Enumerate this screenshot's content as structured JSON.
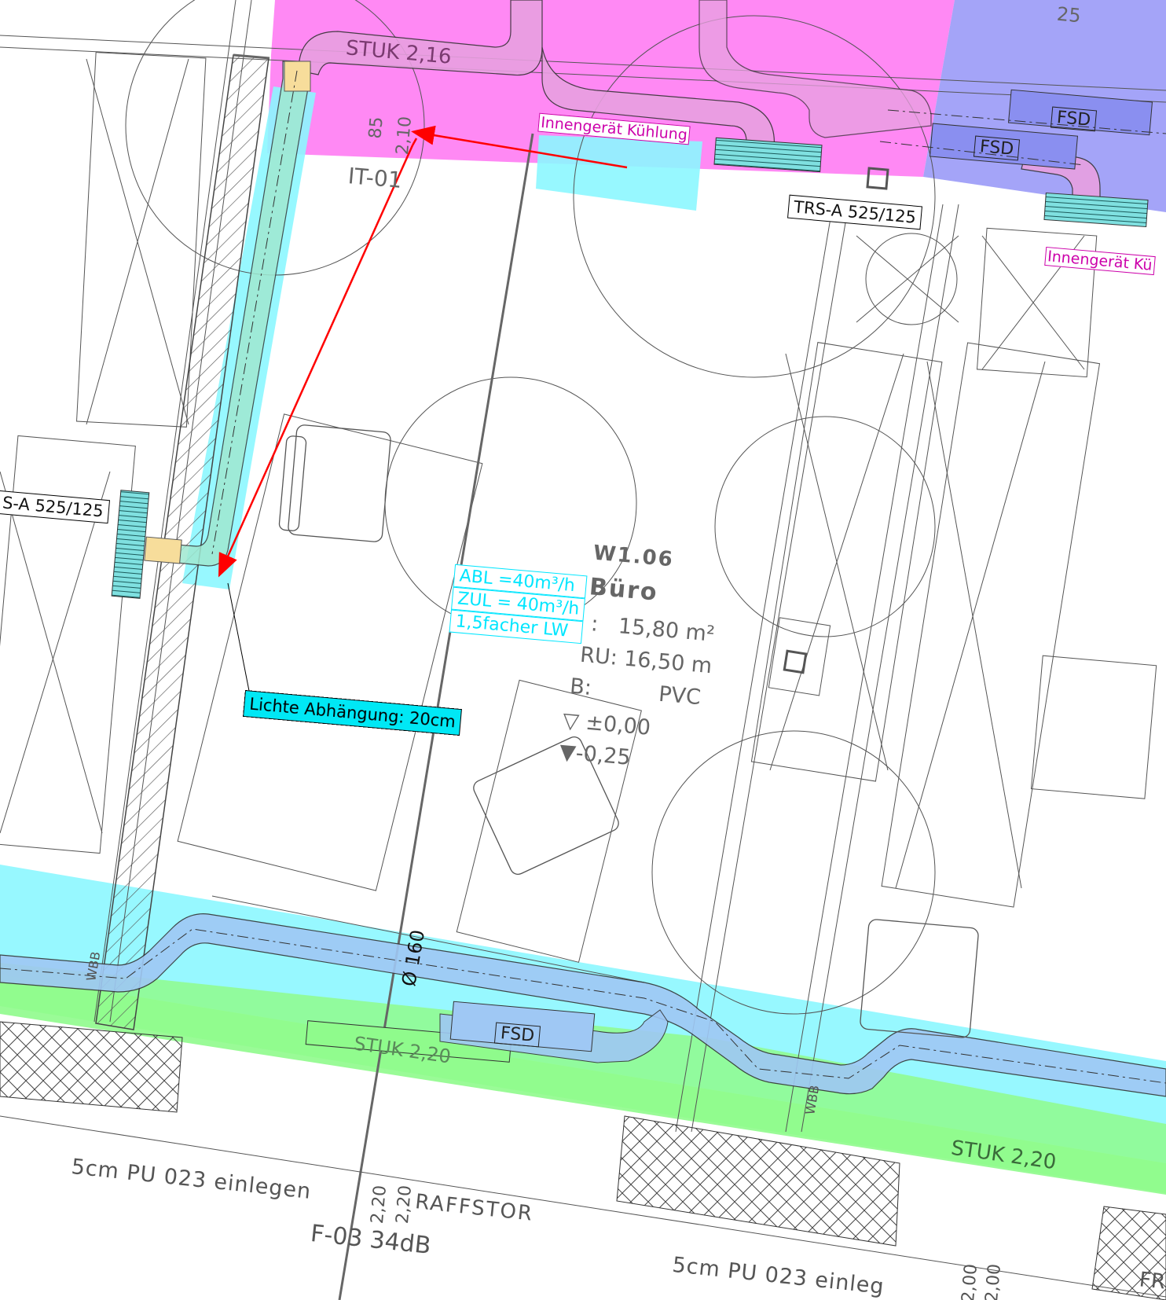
{
  "labels": {
    "stuk_top": "STUK 2,16",
    "stuk_bottom_left": "STUK 2,20",
    "stuk_bottom_right": "STUK 2,20",
    "dim_85": "85",
    "dim_210": "2,10",
    "it_tag": "IT-01",
    "innengeraet_1": "Innengerät Kühlung",
    "innengeraet_2": "Innengerät Kü",
    "trs_right": "TRS-A 525/125",
    "trs_left": "S-A 525/125",
    "fsd_1": "FSD",
    "fsd_2": "FSD",
    "fsd_3": "FSD",
    "top_right_num": "25",
    "room_number": "W1.06",
    "room_name": "Büro",
    "room_area": ":   15,80 m²",
    "room_ru": "RU: 16,50 m",
    "room_floor": "B:          PVC",
    "room_level_1": "±0,00",
    "room_level_2": "-0,25",
    "abl": "ABL =40m³/h",
    "zul": "ZUL = 40m³/h",
    "factor": "1,5facher LW",
    "lichte": "Lichte Abhängung: 20cm",
    "duct_dia": "Ø 160",
    "wbb_1": "WBB",
    "wbb_2": "WBB",
    "pu_1": "5cm PU 023 einlegen",
    "pu_2": "5cm PU 023 einleg",
    "dim_220_a": "2,20",
    "dim_220_b": "2,20",
    "raffstor": "RAFFSTOR",
    "f03": "F-03 34dB",
    "dim_200_a": "2,00",
    "dim_200_b": "2,00",
    "fr": "FR"
  },
  "colors": {
    "magenta_zone": "#ff7cf3",
    "blue_zone": "#9f9ff8",
    "cyan_zone": "#8cf7ff",
    "green_zone": "#8ffb8c",
    "duct_fill": "#9fc8f4",
    "arrow_red": "#ff0000",
    "label_magenta": "#cc00aa",
    "label_cyan": "#00e6ff",
    "callout_fill": "#00e8f5"
  }
}
